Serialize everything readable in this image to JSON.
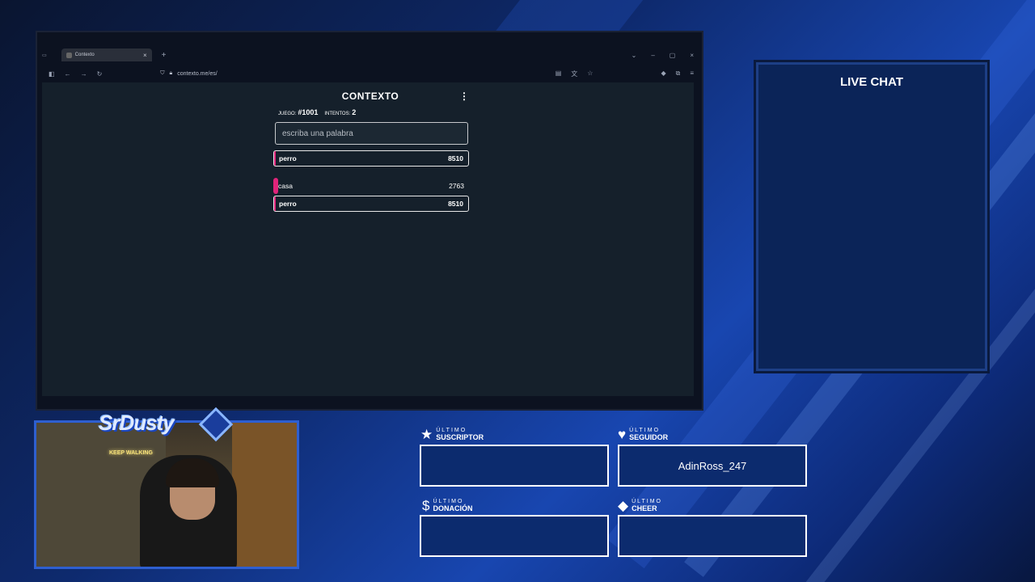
{
  "browser": {
    "tab_title": "Contexto",
    "url": "contexto.me/es/"
  },
  "game": {
    "title": "CONTEXTO",
    "menu_icon": "more-vertical-icon",
    "game_label": "JUEGO:",
    "game_number": "#1001",
    "attempts_label": "INTENTOS:",
    "attempts": "2",
    "input_placeholder": "escriba una palabra",
    "last_guess": {
      "word": "perro",
      "rank": "8510"
    },
    "guesses": [
      {
        "word": "casa",
        "rank": "2763",
        "fill": 0.02
      },
      {
        "word": "perro",
        "rank": "8510",
        "fill": 0.01
      }
    ],
    "accent_color": "#e0247a"
  },
  "chat": {
    "title": "LIVE CHAT"
  },
  "overlay": {
    "logo_text": "SrDusty",
    "neon_sign": "KEEP WALKING",
    "stats": [
      {
        "icon": "star-icon",
        "small": "ÚLTIMO",
        "big": "SUSCRIPTOR",
        "value": ""
      },
      {
        "icon": "heart-icon",
        "small": "ÚLTIMO",
        "big": "SEGUIDOR",
        "value": "AdinRoss_247"
      },
      {
        "icon": "dollar-icon",
        "small": "ÚLTIMO",
        "big": "DONACIÓN",
        "value": ""
      },
      {
        "icon": "diamond-icon",
        "small": "ÚLTIMO",
        "big": "CHEER",
        "value": ""
      }
    ]
  }
}
